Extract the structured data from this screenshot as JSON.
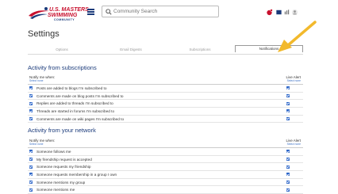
{
  "header": {
    "logo_line1": "U.S. MASTERS",
    "logo_line2": "SWIMMING",
    "logo_line3": "COMMUNITY",
    "search_placeholder": "Community Search"
  },
  "page": {
    "title": "Settings"
  },
  "tabs": [
    {
      "label": "Options",
      "active": false
    },
    {
      "label": "Email Digests",
      "active": false
    },
    {
      "label": "Subscriptions",
      "active": false
    },
    {
      "label": "Notifications",
      "active": true
    }
  ],
  "sections": [
    {
      "title": "Activity from subscriptions",
      "notify_header": "Notify me when:",
      "select_none": "Select none",
      "live_alert_header": "Live Alert",
      "rows": [
        "Posts are added to blogs I'm subscribed to",
        "Comments are made on blog posts I'm subscribed to",
        "Replies are added to threads I'm subscribed to",
        "Threads are started in forums I'm subscribed to",
        "Comments are made on wiki pages I'm subscribed to"
      ]
    },
    {
      "title": "Activity from your network",
      "notify_header": "Notify me when:",
      "select_none": "Select none",
      "live_alert_header": "Live Alert",
      "rows": [
        "Someone follows me",
        "My friendship request is accepted",
        "Someone requests my friendship",
        "Someone requests membership in a group I own",
        "Someone mentions my group",
        "Someone mentions me"
      ]
    }
  ],
  "colors": {
    "brand_red": "#c8102e",
    "brand_navy": "#1a3a7a",
    "link_blue": "#3a6fc4",
    "checkbox_blue": "#2a64c8",
    "arrow_yellow": "#f2b92c"
  }
}
